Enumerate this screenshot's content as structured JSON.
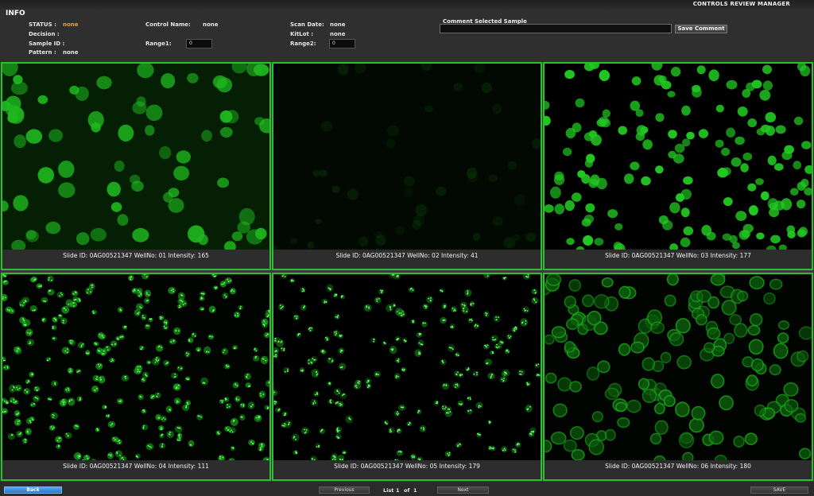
{
  "app_title": "CONTROLS REVIEW MANAGER",
  "info": {
    "title": "INFO",
    "status_label": "STATUS :",
    "status_value": "none",
    "decision_label": "Decision :",
    "sample_id_label": "Sample ID :",
    "pattern_label": "Pattern :",
    "pattern_value": "none",
    "control_name_label": "Control Name:",
    "control_name_value": "none",
    "range1_label": "Range1:",
    "range1_value": "0",
    "scan_date_label": "Scan Date:",
    "scan_date_value": "none",
    "kitlot_label": "KitLot :",
    "kitlot_value": "none",
    "range2_label": "Range2:",
    "range2_value": "0"
  },
  "comment": {
    "title": "Comment Selected Sample",
    "value": "",
    "save_label": "Save Comment"
  },
  "colors": {
    "accent": "#2fbe2f",
    "status": "#f0a030",
    "back_button": "#3d8ad8"
  },
  "panels": [
    {
      "caption": "Slide ID: 0AG00521347  WellNo: 01  Intensity: 165",
      "image": "fluorescent cells, bright green cytoplasm and nuclei"
    },
    {
      "caption": "Slide ID: 0AG00521347  WellNo: 02  Intensity: 41",
      "image": "very dim green field, mostly dark"
    },
    {
      "caption": "Slide ID: 0AG00521347  WellNo: 03  Intensity: 177",
      "image": "dense round bright green nuclei"
    },
    {
      "caption": "Slide ID: 0AG00521347  WellNo: 04  Intensity: 111",
      "image": "many small speckled green nuclei"
    },
    {
      "caption": "Slide ID: 0AG00521347  WellNo: 05  Intensity: 179",
      "image": "nuclei with bright green dots"
    },
    {
      "caption": "Slide ID: 0AG00521347  WellNo: 06  Intensity: 180",
      "image": "dense round green nuclei with rim staining"
    }
  ],
  "footer": {
    "back_label": "Back",
    "previous_label": "Previous",
    "list_label": "List",
    "page_current": "1",
    "of_label": "of",
    "page_total": "1",
    "next_label": "Next",
    "save_label": "SAVE"
  }
}
